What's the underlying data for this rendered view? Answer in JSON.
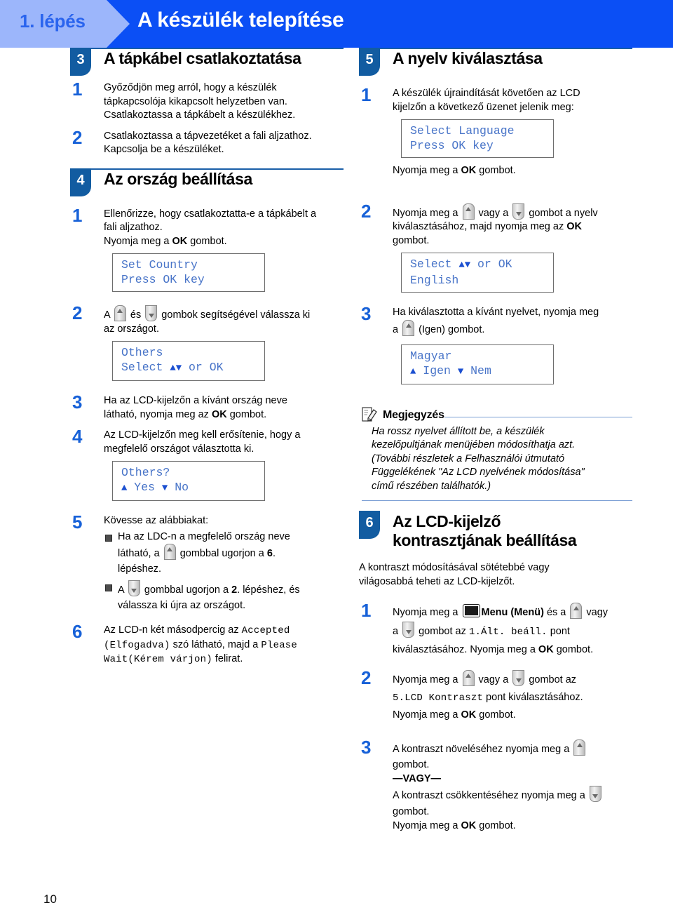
{
  "banner": {
    "step_label": "1. lépés",
    "title": "A készülék telepítése",
    "bg_color": "#0b4ff5",
    "tab_color": "#9cb6fb"
  },
  "page_number": "10",
  "colors": {
    "section_badge": "#125ca1",
    "step_number": "#1761d8",
    "lcd_text": "#4874c8",
    "rule": "#1a5fa8",
    "note_rule": "#7b9fd4"
  },
  "left_column": {
    "section3": {
      "number": "3",
      "title": "A tápkábel csatlakoztatása",
      "steps": [
        {
          "number": "1",
          "lines": [
            "Győződjön meg arról, hogy a készülék",
            "tápkapcsolója kikapcsolt helyzetben van.",
            "Csatlakoztassa a tápkábelt a készülékhez."
          ]
        },
        {
          "number": "2",
          "lines": [
            "Csatlakoztassa a tápvezetéket a fali aljzathoz.",
            "Kapcsolja be a készüléket."
          ]
        }
      ]
    },
    "section4": {
      "number": "4",
      "title": "Az ország beállítása",
      "step1": {
        "number": "1",
        "line1": "Ellenőrizze, hogy csatlakoztatta-e a tápkábelt a",
        "line2": "fali aljzathoz.",
        "line3_pre": "Nyomja meg a ",
        "line3_key": "OK",
        "line3_post": " gombot.",
        "lcd": [
          "Set Country",
          "Press OK key"
        ]
      },
      "step2": {
        "number": "2",
        "pre": "A ",
        "mid": " és ",
        "post": " gombok segítségével válassza ki",
        "line2": "az országot.",
        "lcd_line1": "Others",
        "lcd_line2_pre": "Select ",
        "lcd_line2_arrows": "▲▼",
        "lcd_line2_post": " or OK"
      },
      "step3": {
        "number": "3",
        "line1": "Ha az LCD-kijelzőn a kívánt ország neve",
        "line2_pre": "látható, nyomja meg az ",
        "line2_key": "OK",
        "line2_post": " gombot."
      },
      "step4": {
        "number": "4",
        "line1": "Az LCD-kijelzőn meg kell erősítenie, hogy a",
        "line2": "megfelelő országot választotta ki.",
        "lcd_line1": "Others?",
        "lcd_line2_up": "▲",
        "lcd_line2_yes": " Yes ",
        "lcd_line2_down": "▼",
        "lcd_line2_no": " No"
      },
      "step5": {
        "number": "5",
        "intro": "Kövesse az alábbiakat:",
        "bullet1_a": "Ha az LDC-n a megfelelő ország neve",
        "bullet1_b_pre": "látható, a ",
        "bullet1_b_mid": " gombbal ugorjon a ",
        "bullet1_b_num": "6",
        "bullet1_b_post": ".",
        "bullet1_c": "lépéshez.",
        "bullet2_pre": "A ",
        "bullet2_mid": " gombbal ugorjon a ",
        "bullet2_num": "2",
        "bullet2_post": ". lépéshez, és",
        "bullet2_b": "válassza ki újra az országot."
      },
      "step6": {
        "number": "6",
        "t1": "Az LCD-n két másodpercig az ",
        "m1": "Accepted",
        "m2": "(Elfogadva)",
        "t2": " szó látható, majd a ",
        "m3": "Please",
        "m4": "Wait(Kérem várjon)",
        "t3": " felirat."
      }
    }
  },
  "right_column": {
    "section5": {
      "number": "5",
      "title": "A nyelv kiválasztása",
      "step1": {
        "number": "1",
        "line1": "A készülék újraindítását követően az LCD",
        "line2": "kijelzőn a következő üzenet jelenik meg:",
        "lcd": [
          "Select Language",
          "Press OK key"
        ],
        "after_pre": "Nyomja meg a ",
        "after_key": "OK",
        "after_post": " gombot."
      },
      "step2": {
        "number": "2",
        "pre": "Nyomja meg a ",
        "mid": " vagy a ",
        "post": " gombot a nyelv",
        "line2_pre": "kiválasztásához, majd nyomja meg az ",
        "line2_key": "OK",
        "line3": "gombot.",
        "lcd_line1_pre": "Select ",
        "lcd_line1_arrows": "▲▼",
        "lcd_line1_post": " or OK",
        "lcd_line2": "English"
      },
      "step3": {
        "number": "3",
        "line1": "Ha kiválasztotta a kívánt nyelvet, nyomja meg",
        "line2_pre": "a ",
        "line2_post": " (Igen) gombot.",
        "lcd_line1": "Magyar",
        "lcd_line2_up": "▲",
        "lcd_line2_yes": " Igen ",
        "lcd_line2_down": "▼",
        "lcd_line2_no": " Nem"
      },
      "note": {
        "heading": "Megjegyzés",
        "lines": [
          "Ha rossz nyelvet állított be, a készülék",
          "kezelőpultjának menüjében módosíthatja azt.",
          "(További részletek a Felhasználói útmutató",
          "Függelékének \"Az LCD nyelvének módosítása\"",
          "című részében találhatók.)"
        ]
      }
    },
    "section6": {
      "number": "6",
      "title_line1": "Az LCD-kijelző",
      "title_line2": "kontrasztjának beállítása",
      "intro_line1": "A kontraszt módosításával sötétebbé vagy",
      "intro_line2": "világosabbá teheti az LCD-kijelzőt.",
      "step1": {
        "number": "1",
        "pre": "Nyomja meg a ",
        "menu_label": "Menu (Menü)",
        "mid": " és a ",
        "post": " vagy",
        "line2_pre": "a ",
        "line2_mid": " gombot az ",
        "line2_mono": "1.Ált. beáll.",
        "line2_post": " pont",
        "line3_pre": "kiválasztásához. Nyomja meg a ",
        "line3_key": "OK",
        "line3_post": " gombot."
      },
      "step2": {
        "number": "2",
        "pre": "Nyomja meg a ",
        "mid": " vagy a ",
        "post": " gombot az",
        "line2_mono": "5.LCD Kontraszt",
        "line2_post": " pont kiválasztásához.",
        "line3_pre": "Nyomja meg a ",
        "line3_key": "OK",
        "line3_post": " gombot."
      },
      "step3": {
        "number": "3",
        "line1": "A kontraszt növeléséhez nyomja meg a ",
        "line2": "gombot.",
        "or_label": "—VAGY—",
        "line3": "A kontraszt csökkentéséhez nyomja meg a ",
        "line4": "gombot.",
        "line5_pre": "Nyomja meg a ",
        "line5_key": "OK",
        "line5_post": " gombot."
      }
    }
  }
}
